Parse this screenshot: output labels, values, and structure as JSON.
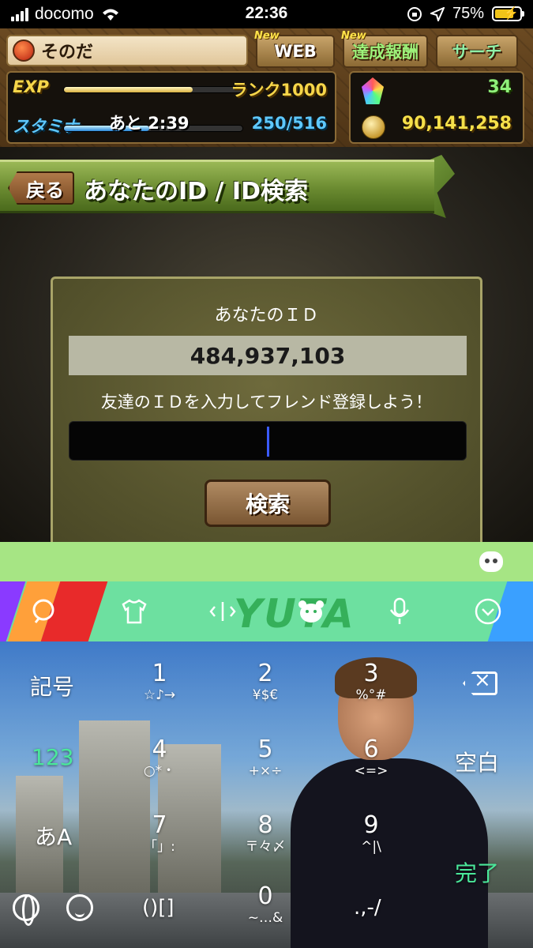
{
  "status_bar": {
    "carrier": "docomo",
    "time": "22:36",
    "battery_percent": "75%",
    "icons": [
      "signal-icon",
      "wifi-icon",
      "rotation-lock-icon",
      "location-icon",
      "battery-charging-icon"
    ]
  },
  "header": {
    "player_name": "そのだ",
    "buttons": {
      "web": "WEB",
      "achievements": "達成報酬",
      "search": "サーチ"
    },
    "new_badge": "New",
    "exp_label": "EXP",
    "rank": "ランク1000",
    "exp_progress": 0.72,
    "stamina_label": "スタミナ",
    "stamina_timer": "あと 2:39",
    "stamina": "250/516",
    "stamina_progress": 0.48,
    "magic_stones": "34",
    "coins": "90,141,258"
  },
  "page": {
    "back": "戻る",
    "title": "あなたのID / ID検索"
  },
  "id_panel": {
    "your_id_label": "あなたのＩＤ",
    "your_id": "484,937,103",
    "prompt": "友達のＩＤを入力してフレンド登録しよう！",
    "input_value": "",
    "search_button": "検索"
  },
  "keyboard": {
    "brand": "YUTA",
    "toolbar_icons": [
      "search-icon",
      "tshirt-icon",
      "cursor-move-icon",
      "bear-icon",
      "mic-icon",
      "collapse-icon"
    ],
    "left_keys": {
      "symbols": "記号",
      "numbers": "123",
      "kana": "あA"
    },
    "right_keys": {
      "space": "空白",
      "done": "完了"
    },
    "keys": [
      {
        "main": "1",
        "sub": "☆♪→"
      },
      {
        "main": "2",
        "sub": "¥$€"
      },
      {
        "main": "3",
        "sub": "%°#"
      },
      {
        "main": "4",
        "sub": "○*・"
      },
      {
        "main": "5",
        "sub": "+×÷"
      },
      {
        "main": "6",
        "sub": "<=>"
      },
      {
        "main": "7",
        "sub": "「」:"
      },
      {
        "main": "8",
        "sub": "〒々〆"
      },
      {
        "main": "9",
        "sub": "^|\\"
      },
      {
        "main": "0",
        "sub": "~…&"
      }
    ],
    "bottom": {
      "brackets": "()[]",
      "punct": ".,-/"
    }
  }
}
